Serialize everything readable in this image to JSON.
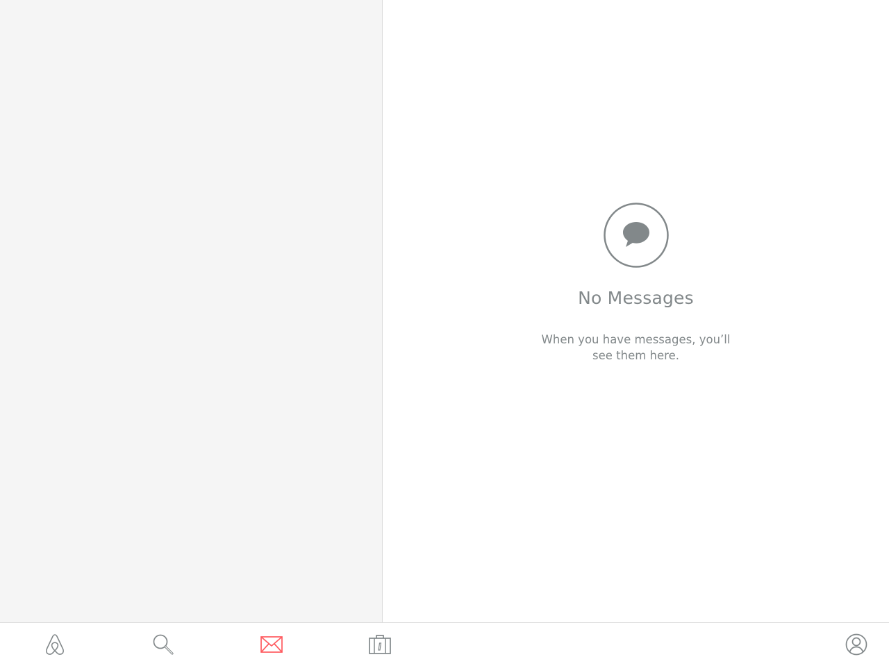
{
  "colors": {
    "active": "#ff5a5f",
    "inactive": "#82888a",
    "sidebar_bg": "#f5f5f5",
    "divider": "#dcdcdc"
  },
  "empty_state": {
    "icon": "chat-bubble-icon",
    "title": "No Messages",
    "body": "When you have messages, you’ll see them here."
  },
  "tab_bar": {
    "active_tab": "inbox",
    "tabs": [
      {
        "id": "home",
        "icon": "airbnb-logo-icon"
      },
      {
        "id": "search",
        "icon": "search-icon"
      },
      {
        "id": "inbox",
        "icon": "envelope-icon"
      },
      {
        "id": "trips",
        "icon": "suitcase-icon"
      },
      {
        "id": "profile",
        "icon": "profile-icon"
      }
    ]
  }
}
